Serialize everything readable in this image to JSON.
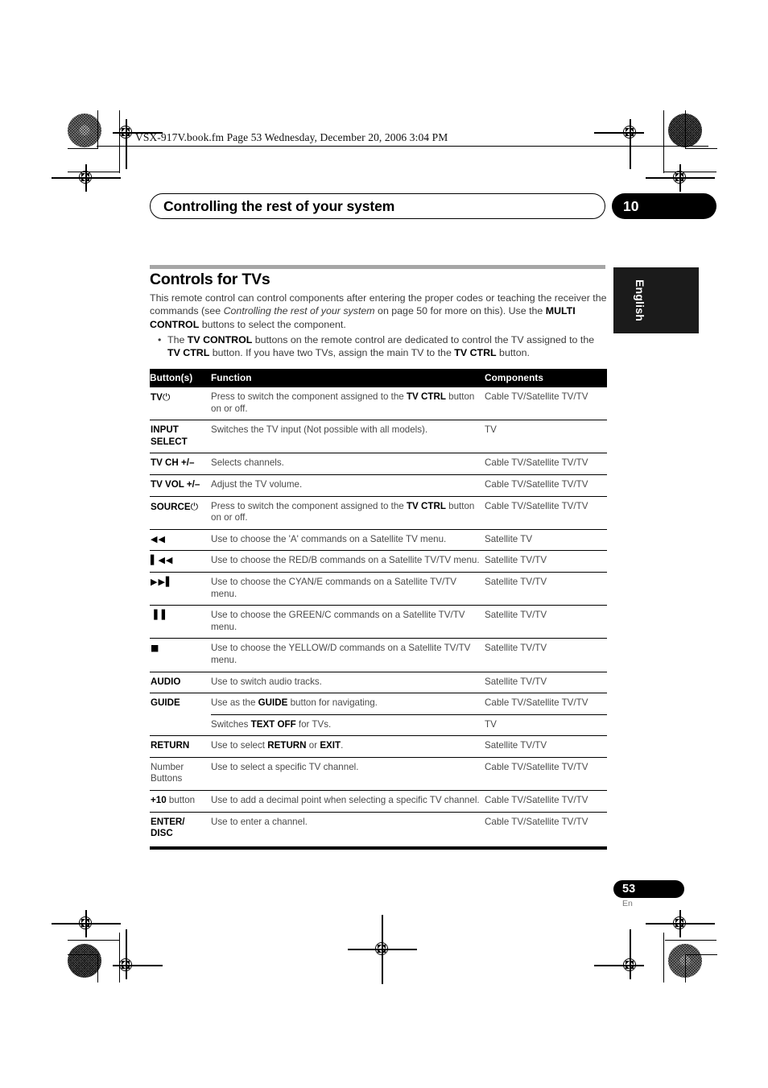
{
  "slug": {
    "filename_line": "VSX-917V.book.fm  Page 53  Wednesday, December 20, 2006  3:04 PM"
  },
  "header": {
    "running_title": "Controlling the rest of your system",
    "chapter_number": "10"
  },
  "side_tab": {
    "label": "English"
  },
  "section": {
    "title": "Controls for TVs",
    "intro_html": "This remote control can control components after entering the proper codes or teaching the receiver the commands (see <i>Controlling the rest of your system</i> on page 50 for more on this). Use the <b>MULTI CONTROL</b> buttons to select the component.",
    "bullets": [
      {
        "marker": "•",
        "text_html": "The <b>TV CONTROL</b> buttons on the remote control are dedicated to control the TV assigned to the <b>TV CTRL</b> button. If you have two TVs, assign the main TV to the <b>TV CTRL</b> button."
      }
    ]
  },
  "table": {
    "headers": [
      "Button(s)",
      "Function",
      "Components"
    ],
    "rows": [
      {
        "button_html": "TV<span class=\"pwr\">⏻</span>",
        "button_name": "tv-power-button",
        "function_html": "Press to switch the component assigned to the <b>TV CTRL</b> button on or off.",
        "components": "Cable TV/Satellite TV/TV",
        "rule": "none"
      },
      {
        "button_html": "INPUT<br>SELECT",
        "button_name": "input-select-button",
        "function_html": "Switches the TV input (Not possible with all models).",
        "components": "TV",
        "rule": "full"
      },
      {
        "button_html": "TV CH +/–",
        "button_name": "tv-ch-button",
        "function_html": "Selects channels.",
        "components": "Cable TV/Satellite TV/TV",
        "rule": "full"
      },
      {
        "button_html": "TV VOL +/–",
        "button_name": "tv-vol-button",
        "function_html": "Adjust the TV volume.",
        "components": "Cable TV/Satellite TV/TV",
        "rule": "full"
      },
      {
        "button_html": "SOURCE<span class=\"pwr\">⏻</span>",
        "button_name": "source-power-button",
        "function_html": "Press to switch the component assigned to the <b>TV CTRL</b> button on or off.",
        "components": "Cable TV/Satellite TV/TV",
        "rule": "full"
      },
      {
        "button_html": "<span class=\"glyph\">◀◀</span>",
        "button_name": "rewind-icon-button",
        "function_html": "Use to choose the 'A' commands on a Satellite TV menu.",
        "components": "Satellite TV",
        "rule": "full"
      },
      {
        "button_html": "<span class=\"glyph\">▌◀◀</span>",
        "button_name": "previous-track-icon-button",
        "function_html": "Use to choose the RED/B commands on a Satellite TV/TV menu.",
        "components": "Satellite TV/TV",
        "rule": "full"
      },
      {
        "button_html": "<span class=\"glyph\">▶▶▌</span>",
        "button_name": "next-track-icon-button",
        "function_html": "Use to choose the CYAN/E commands on a Satellite TV/TV menu.",
        "components": "Satellite TV/TV",
        "rule": "full"
      },
      {
        "button_html": "<span class=\"glyph\">▐▐</span>",
        "button_name": "pause-icon-button",
        "function_html": "Use to choose the GREEN/C commands on a Satellite TV/TV menu.",
        "components": "Satellite TV/TV",
        "rule": "full"
      },
      {
        "button_html": "<span class=\"glyph\">■</span>",
        "button_name": "stop-icon-button",
        "function_html": "Use to choose the YELLOW/D commands on a Satellite TV/TV menu.",
        "components": "Satellite TV/TV",
        "rule": "full"
      },
      {
        "button_html": "AUDIO",
        "button_name": "audio-button",
        "function_html": "Use to switch audio tracks.",
        "components": "Satellite TV/TV",
        "rule": "full"
      },
      {
        "button_html": "GUIDE",
        "button_name": "guide-button",
        "function_html": "Use as the <b>GUIDE</b> button for navigating.",
        "components": "Cable TV/Satellite TV/TV",
        "rule": "full"
      },
      {
        "button_html": "",
        "button_name": "guide-button-secondary",
        "function_html": "Switches <b>TEXT OFF</b> for TVs.",
        "components": "TV",
        "rule": "indent"
      },
      {
        "button_html": "RETURN",
        "button_name": "return-button",
        "function_html": "Use to select <b>RETURN</b> or <b>EXIT</b>.",
        "components": "Satellite TV/TV",
        "rule": "full"
      },
      {
        "button_html": "Number<br>Buttons",
        "button_name": "number-buttons",
        "button_plain": true,
        "function_html": "Use to select a specific TV channel.",
        "components": "Cable TV/Satellite TV/TV",
        "rule": "full"
      },
      {
        "button_html": "+10<span class=\"sfx\"> button</span>",
        "button_name": "plus-ten-button",
        "function_html": "Use to add a decimal point when selecting a specific TV channel.",
        "components": "Cable TV/Satellite TV/TV",
        "rule": "full"
      },
      {
        "button_html": "ENTER/<br>DISC",
        "button_name": "enter-disc-button",
        "function_html": "Use to enter a channel.",
        "components": "Cable TV/Satellite TV/TV",
        "rule": "full"
      }
    ]
  },
  "footer": {
    "page_number": "53",
    "language_code": "En"
  },
  "colors": {
    "section_rule": "#a6a6a6",
    "tab_black": "#1b1b1b",
    "body_text": "#3b3b3b",
    "table_text": "#4a4a4a"
  }
}
